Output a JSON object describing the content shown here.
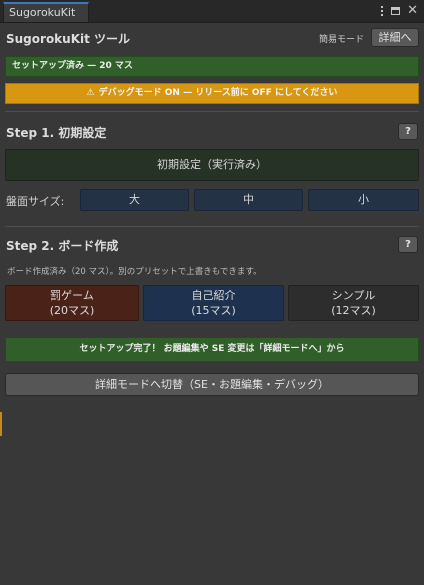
{
  "window": {
    "tab_title": "SugorokuKit",
    "icons": [
      "kebab-menu-icon",
      "maximize-icon",
      "close-icon"
    ]
  },
  "header": {
    "title": "SugorokuKit ツール",
    "mode_label": "簡易モード",
    "detail_button": "詳細へ"
  },
  "status": {
    "setup_text": "セットアップ済み — 20 マス",
    "warning_icon": "warning-icon",
    "warning_text": "デバッグモード ON — リリース前に OFF にしてください"
  },
  "step1": {
    "title": "Step 1. 初期設定",
    "help": "?",
    "init_button": "初期設定（実行済み）",
    "size_label": "盤面サイズ:",
    "sizes": [
      "大",
      "中",
      "小"
    ]
  },
  "step2": {
    "title": "Step 2. ボード作成",
    "help": "?",
    "description": "ボード作成済み（20 マス）。別のプリセットで上書きもできます。",
    "presets": [
      {
        "name": "罰ゲーム",
        "count": "(20マス)"
      },
      {
        "name": "自己紹介",
        "count": "(15マス)"
      },
      {
        "name": "シンプル",
        "count": "(12マス)"
      }
    ]
  },
  "footer": {
    "complete_text": "セットアップ完了！ お題編集や SE 変更は「詳細モードへ」から",
    "switch_button": "詳細モードへ切替（SE・お題編集・デバッグ）"
  },
  "colors": {
    "background": "#383838",
    "success": "#305f2a",
    "warning": "#d79711",
    "accent_blue": "#3a79bb",
    "preset_red": "#4b2218",
    "preset_blue": "#1e3250",
    "size_button": "#233245"
  }
}
